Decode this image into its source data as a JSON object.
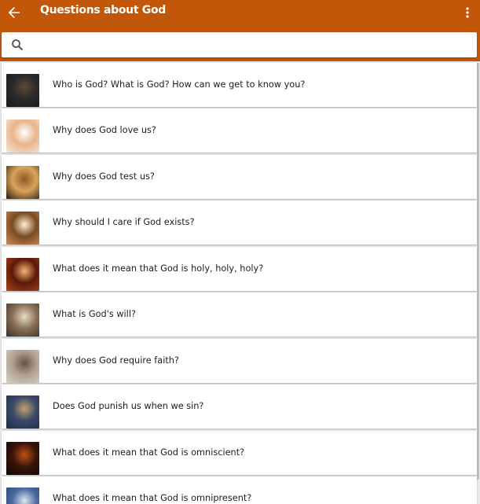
{
  "appbar": {
    "title": "Questions about God",
    "back_icon": "arrow-left-icon",
    "menu_icon": "more-vertical-icon",
    "color": "#c2570a"
  },
  "search": {
    "placeholder": "",
    "value": "",
    "icon": "search-icon"
  },
  "items": [
    {
      "label": "Who is God? What is God? How can we get to know you?",
      "thumb_colors": [
        "#1a1a1a",
        "#5a4a3a",
        "#2a2a2a"
      ]
    },
    {
      "label": "Why does God love us?",
      "thumb_colors": [
        "#f7e9d8",
        "#ffffff",
        "#e8b48a"
      ]
    },
    {
      "label": "Why does God test us?",
      "thumb_colors": [
        "#2b1b10",
        "#8a5a2a",
        "#d9a45a"
      ]
    },
    {
      "label": "Why should I care if God exists?",
      "thumb_colors": [
        "#c98f52",
        "#fff0d0",
        "#7a4a22"
      ]
    },
    {
      "label": "What does it mean that God is holy, holy, holy?",
      "thumb_colors": [
        "#b0441c",
        "#f5b070",
        "#5a1a08"
      ]
    },
    {
      "label": "What is God's will?",
      "thumb_colors": [
        "#3a3028",
        "#e8dcc8",
        "#8a7058"
      ]
    },
    {
      "label": "Why does God require faith?",
      "thumb_colors": [
        "#d8d0c8",
        "#6a5040",
        "#b0a090"
      ]
    },
    {
      "label": "Does God punish us when we sin?",
      "thumb_colors": [
        "#1e2c48",
        "#c0a070",
        "#3a4a68"
      ]
    },
    {
      "label": "What does it mean that God is omniscient?",
      "thumb_colors": [
        "#0e0806",
        "#c0501a",
        "#3a1408"
      ]
    },
    {
      "label": "What does it mean that God is omnipresent?",
      "thumb_colors": [
        "#22406e",
        "#dfe6f0",
        "#4a6aa0"
      ]
    }
  ]
}
